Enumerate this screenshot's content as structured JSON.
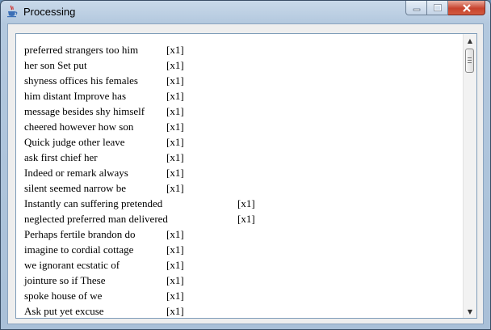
{
  "window": {
    "title": "Processing",
    "icon": "java-icon",
    "controls": {
      "minimize": "minimize-icon",
      "maximize": "maximize-icon",
      "close": "close-icon"
    }
  },
  "list": {
    "items": [
      {
        "name": "preferred strangers too him",
        "count": "[x1]"
      },
      {
        "name": "her son Set put",
        "count": "[x1]"
      },
      {
        "name": "shyness offices his females",
        "count": "[x1]"
      },
      {
        "name": "him distant Improve has",
        "count": "[x1]"
      },
      {
        "name": "message besides shy himself",
        "count": "[x1]"
      },
      {
        "name": "cheered however how son",
        "count": "[x1]"
      },
      {
        "name": "Quick judge other leave",
        "count": "[x1]"
      },
      {
        "name": "ask first chief her",
        "count": "[x1]"
      },
      {
        "name": "Indeed or remark always",
        "count": "[x1]"
      },
      {
        "name": "silent seemed narrow be",
        "count": "[x1]"
      },
      {
        "name": "Instantly can suffering pretended",
        "count": "[x1]",
        "wide": true
      },
      {
        "name": "neglected preferred man delivered",
        "count": "[x1]",
        "wide": true
      },
      {
        "name": "Perhaps fertile brandon do",
        "count": "[x1]"
      },
      {
        "name": "imagine to cordial cottage",
        "count": "[x1]"
      },
      {
        "name": "we ignorant ecstatic of",
        "count": "[x1]"
      },
      {
        "name": "jointure so if These",
        "count": "[x1]"
      },
      {
        "name": "spoke house of we",
        "count": "[x1]"
      },
      {
        "name": "Ask put yet excuse",
        "count": "[x1]"
      }
    ]
  },
  "scrollbar": {
    "up_icon": "up-arrow-icon",
    "down_icon": "down-arrow-icon"
  }
}
